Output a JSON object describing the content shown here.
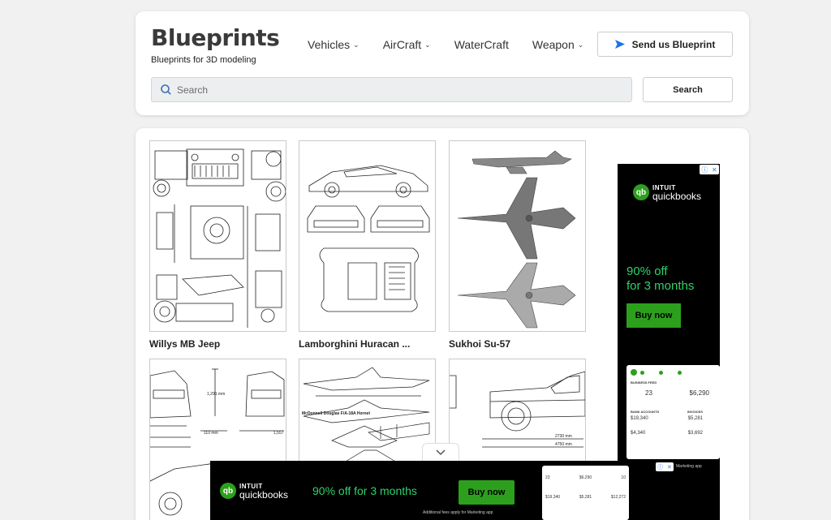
{
  "brand": {
    "title": "Blueprints",
    "subtitle": "Blueprints for 3D modeling"
  },
  "nav": [
    {
      "label": "Vehicles",
      "has_dropdown": true
    },
    {
      "label": "AirCraft",
      "has_dropdown": true
    },
    {
      "label": "WaterCraft",
      "has_dropdown": false
    },
    {
      "label": "Weapon",
      "has_dropdown": true
    }
  ],
  "send_button": {
    "label": "Send us Blueprint",
    "icon": "send-icon"
  },
  "search": {
    "placeholder": "Search",
    "value": "",
    "button_label": "Search"
  },
  "blueprints": [
    {
      "title": "Willys MB Jeep"
    },
    {
      "title": "Lamborghini Huracan ..."
    },
    {
      "title": "Sukhoi Su-57"
    },
    {
      "title": "",
      "labels": [
        "1,291 mm",
        "110 mm",
        "1,557"
      ]
    },
    {
      "title": "",
      "labels": [
        "McDonnell Douglas F/A-18A Hornet"
      ]
    },
    {
      "title": "",
      "labels": [
        "2730 mm",
        "4750 mm"
      ]
    }
  ],
  "side_ad": {
    "brand_intuit": "INTUIT",
    "brand_name": "quickbooks",
    "brand_mark": "qb",
    "offer_line1": "90% off",
    "offer_line2": "for 3 months",
    "button": "Buy now",
    "dashboard": {
      "header": "BUSINESS FEED",
      "count": "23",
      "amount": "$6,290",
      "bank_label": "BANK ACCOUNTS",
      "invoices_label": "INVOICES",
      "bank1": "$19,340",
      "bank2": "$4,340",
      "inv1": "$5,281",
      "inv2": "$3,692"
    },
    "footer_note": "Marketing app"
  },
  "bottom_ad": {
    "brand_intuit": "INTUIT",
    "brand_name": "quickbooks",
    "brand_mark": "qb",
    "offer": "90% off for 3 months",
    "button": "Buy now",
    "note": "Additional fees apply for Marketing app",
    "dashboard": {
      "v1": "23",
      "v2": "$6,290",
      "v3": "10",
      "v4": "$19,340",
      "v5": "$5,281",
      "v6": "$12,272"
    }
  },
  "colors": {
    "ad_green": "#2ca01c",
    "offer_green": "#2ed36b",
    "accent_blue": "#1a73e8"
  }
}
